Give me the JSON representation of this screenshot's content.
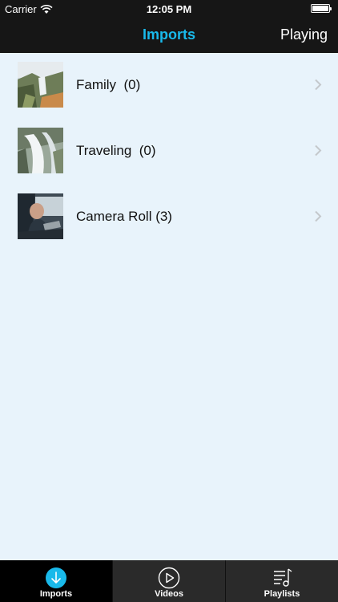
{
  "status": {
    "carrier": "Carrier",
    "time": "12:05 PM"
  },
  "nav": {
    "title": "Imports",
    "right_button": "Playing"
  },
  "rows": [
    {
      "label": "Family  (0)",
      "thumb": "waterfall-cliff"
    },
    {
      "label": "Traveling  (0)",
      "thumb": "waterfall-rapids"
    },
    {
      "label": "Camera Roll (3)",
      "thumb": "man-in-car"
    }
  ],
  "tabs": [
    {
      "label": "Imports",
      "icon": "download-circle-icon",
      "active": true
    },
    {
      "label": "Videos",
      "icon": "play-circle-icon",
      "active": false
    },
    {
      "label": "Playlists",
      "icon": "playlist-icon",
      "active": false
    }
  ],
  "colors": {
    "accent": "#19b9ea",
    "bar": "#161616",
    "background": "#e8f3fb"
  }
}
